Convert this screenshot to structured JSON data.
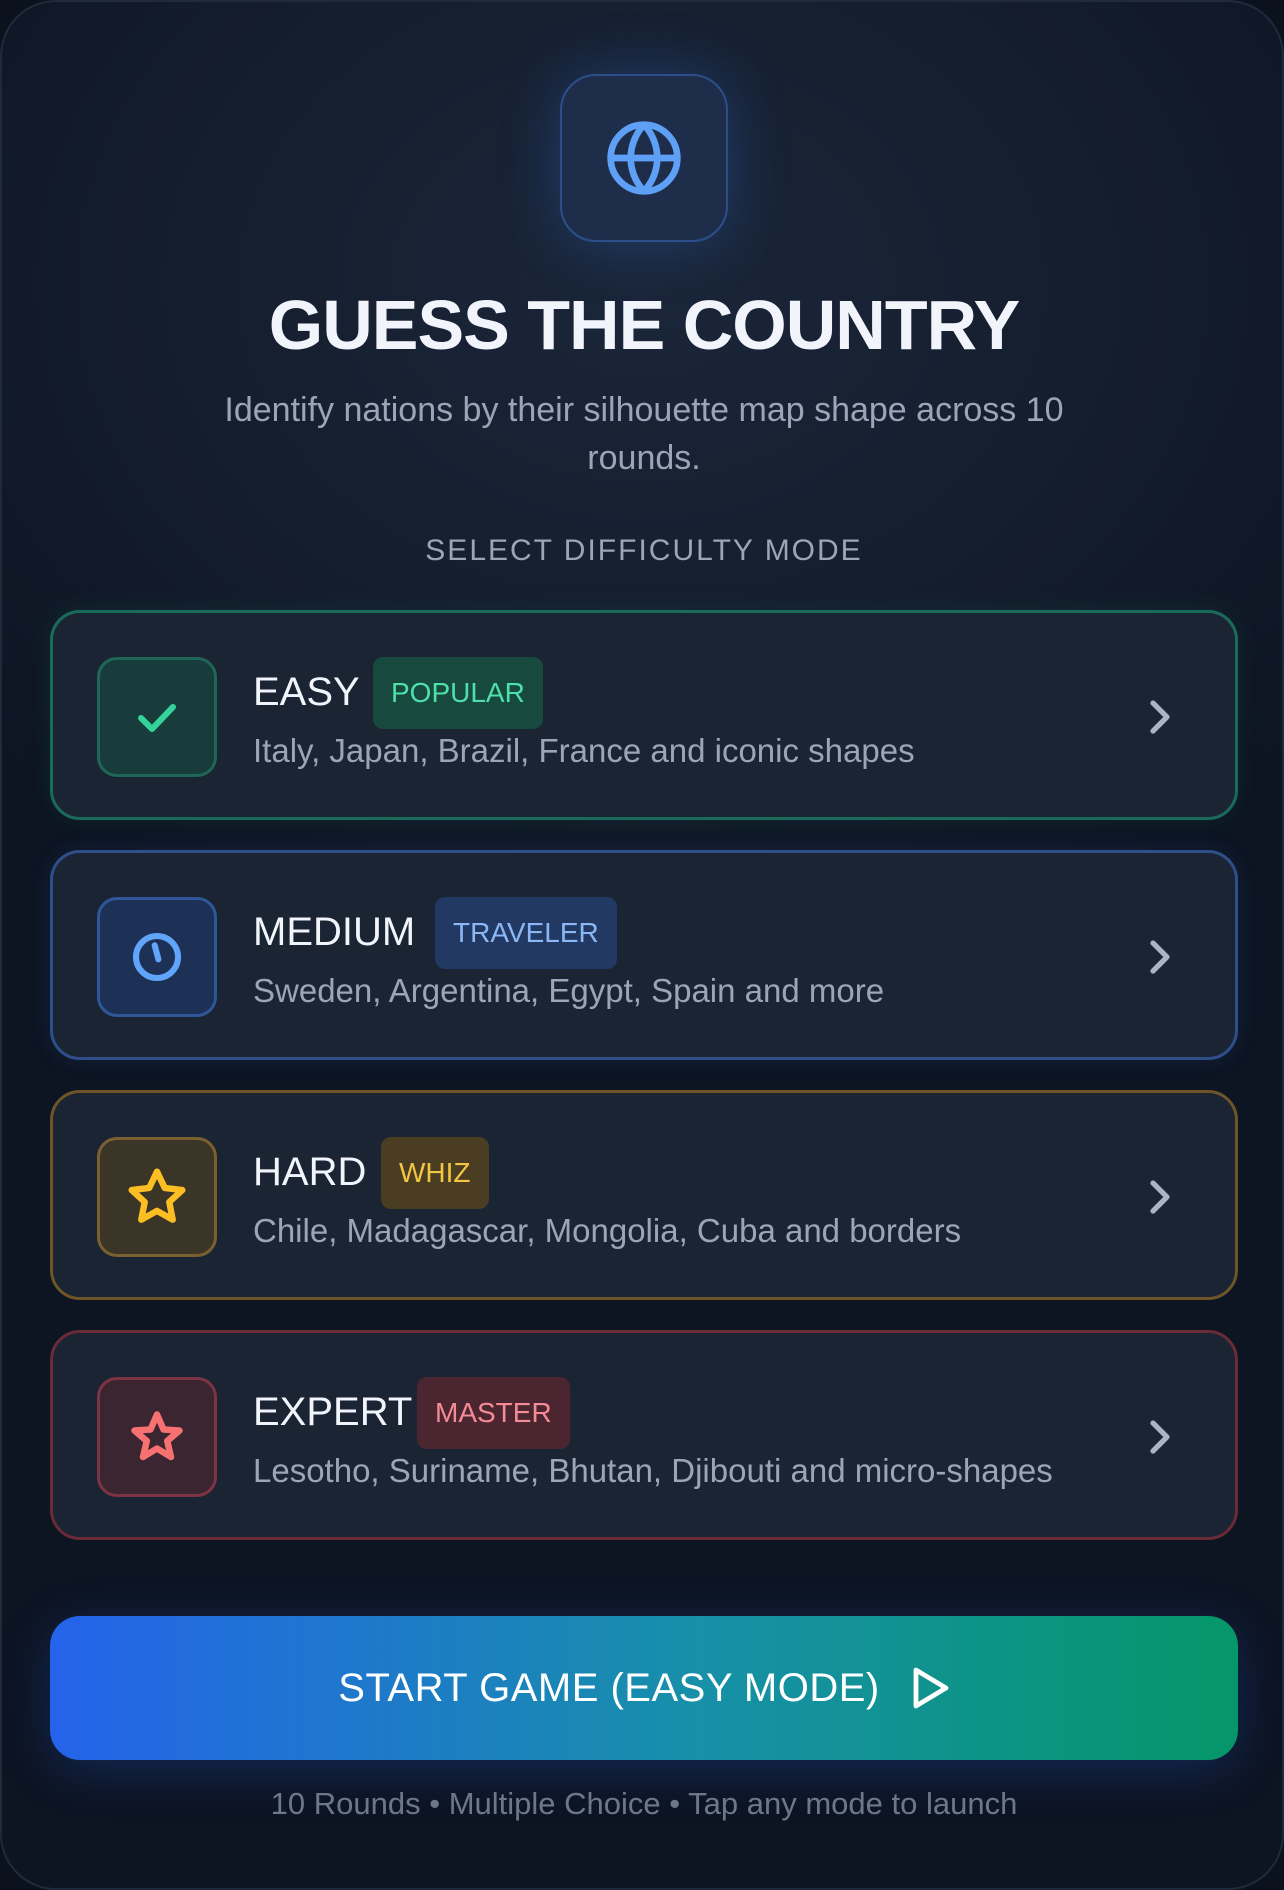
{
  "header": {
    "logo_icon": "globe-icon",
    "title": "GUESS THE COUNTRY",
    "subtitle": "Identify nations by their silhouette map shape across 10 rounds."
  },
  "section_label": "SELECT DIFFICULTY MODE",
  "modes": [
    {
      "name": "EASY",
      "badge": "POPULAR",
      "description": "Italy, Japan, Brazil, France and iconic shapes",
      "icon": "check-icon",
      "accent": "#34d399",
      "selected": true
    },
    {
      "name": "MEDIUM",
      "badge": "TRAVELER",
      "description": "Sweden, Argentina, Egypt, Spain and more",
      "icon": "compass-icon",
      "accent": "#60a5fa",
      "selected": false
    },
    {
      "name": "HARD",
      "badge": "WHIZ",
      "description": "Chile, Madagascar, Mongolia, Cuba and borders",
      "icon": "star-icon",
      "accent": "#fbbf24",
      "selected": false
    },
    {
      "name": "EXPERT",
      "badge": "MASTER",
      "description": "Lesotho, Suriname, Bhutan, Djibouti and micro-shapes",
      "icon": "star-outline-icon",
      "accent": "#f87171",
      "selected": false
    }
  ],
  "start_button": {
    "label": "START GAME (EASY MODE)",
    "icon": "play-icon"
  },
  "footer_note": "10 Rounds • Multiple Choice • Tap any mode to launch",
  "colors": {
    "background": "#141d2d",
    "card": "#1b2433",
    "button_gradient_start": "#2563eb",
    "button_gradient_end": "#059669"
  }
}
